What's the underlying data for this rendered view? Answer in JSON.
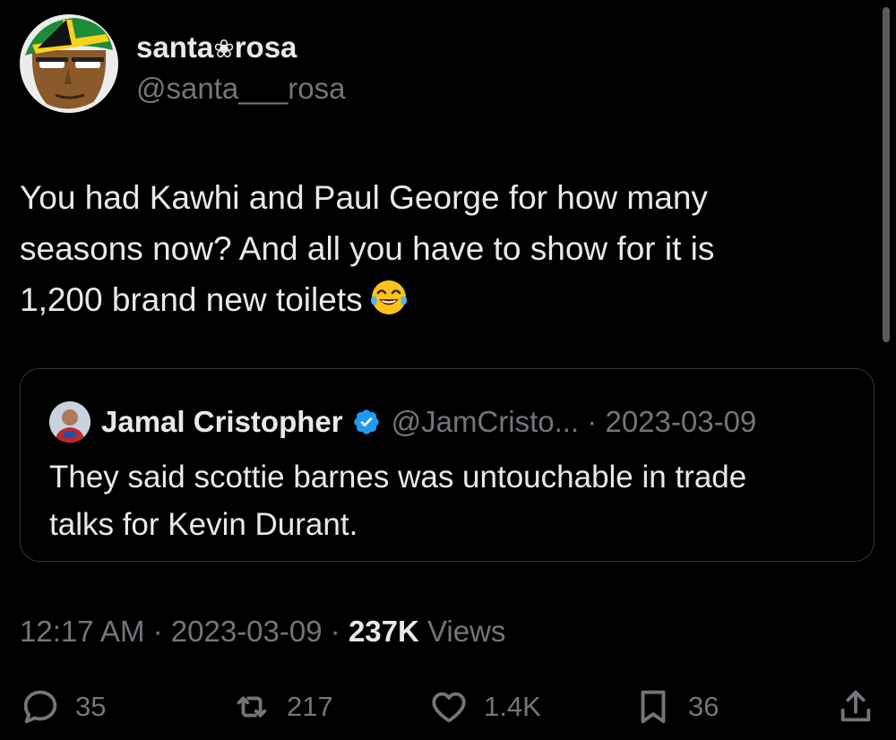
{
  "tweet": {
    "author": {
      "display_name_part1": "santa",
      "display_name_flower": "❀",
      "display_name_part2": "rosa",
      "handle": "@santa___rosa",
      "avatar_icon": "pirate-bandana-avatar"
    },
    "text_lines": [
      "You had Kawhi and Paul George for how many",
      "seasons now? And all you have to show for it is",
      "1,200 brand new toilets"
    ],
    "emoji": "face-with-tears-of-joy",
    "quote": {
      "display_name": "Jamal Cristopher",
      "handle": "@JamCristo...",
      "separator": "·",
      "date": "2023-03-09",
      "text_lines": [
        "They said scottie barnes was untouchable in trade",
        "talks for Kevin Durant."
      ]
    },
    "meta": {
      "time": "12:17 AM",
      "separator": "·",
      "date": "2023-03-09",
      "views_count": "237K",
      "views_label": "Views"
    },
    "actions": {
      "replies": "35",
      "retweets": "217",
      "likes": "1.4K",
      "bookmarks": "36"
    }
  },
  "colors": {
    "background": "#000000",
    "primary_text": "#e7e9ea",
    "secondary_text": "#71767b",
    "border": "#333639",
    "verified_blue": "#1d9bf0"
  }
}
